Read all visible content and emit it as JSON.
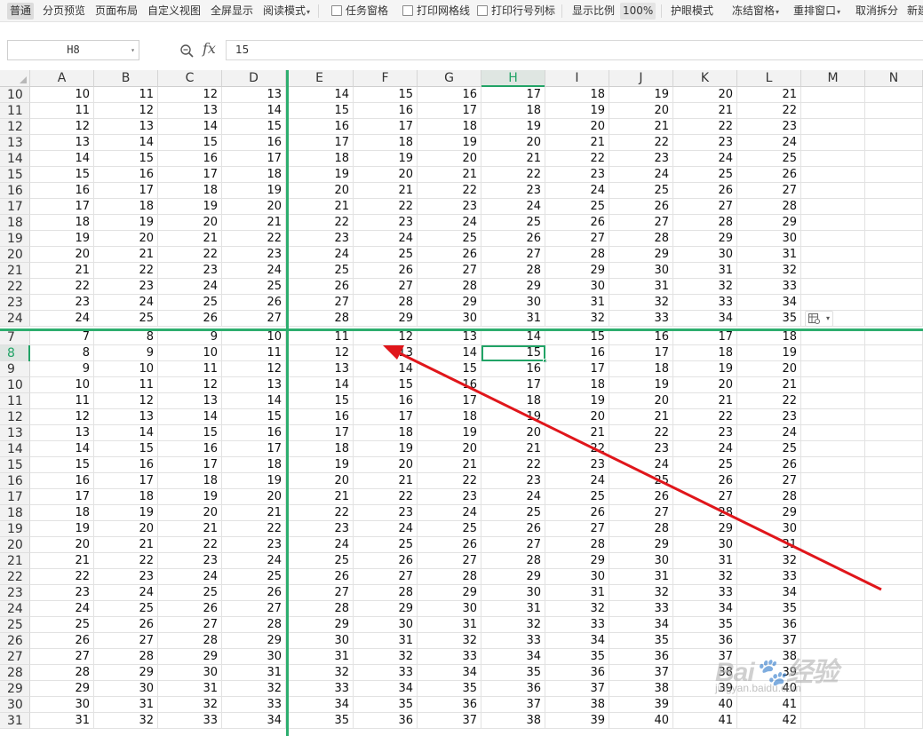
{
  "ribbon": {
    "items": [
      {
        "label": "普通",
        "kind": "button",
        "active": true
      },
      {
        "label": "分页预览",
        "kind": "button"
      },
      {
        "label": "页面布局",
        "kind": "button"
      },
      {
        "label": "自定义视图",
        "kind": "button"
      },
      {
        "label": "全屏显示",
        "kind": "button"
      },
      {
        "label": "阅读模式",
        "kind": "dropdown"
      },
      {
        "label": "任务窗格",
        "kind": "checkbox"
      },
      {
        "label": "打印网格线",
        "kind": "checkbox"
      },
      {
        "label": "打印行号列标",
        "kind": "checkbox"
      },
      {
        "label": "显示比例",
        "kind": "button"
      },
      {
        "label": "100%",
        "kind": "zoom"
      },
      {
        "label": "护眼模式",
        "kind": "button"
      },
      {
        "label": "冻结窗格",
        "kind": "dropdown"
      },
      {
        "label": "重排窗口",
        "kind": "dropdown"
      },
      {
        "label": "取消拆分",
        "kind": "button"
      },
      {
        "label": "新建",
        "kind": "button"
      }
    ]
  },
  "formula_bar": {
    "name_box": "H8",
    "fx": "fx",
    "value": "15"
  },
  "columns": [
    "A",
    "B",
    "C",
    "D",
    "E",
    "F",
    "G",
    "H",
    "I",
    "J",
    "K",
    "L",
    "M",
    "N"
  ],
  "selected_column": "H",
  "selected_row": "8",
  "active_cell": {
    "row": 8,
    "col": "H",
    "value": 15
  },
  "top_pane": {
    "rows": [
      {
        "n": "10",
        "cells": [
          10,
          11,
          12,
          13,
          14,
          15,
          16,
          17,
          18,
          19,
          20,
          21
        ]
      },
      {
        "n": "11",
        "cells": [
          11,
          12,
          13,
          14,
          15,
          16,
          17,
          18,
          19,
          20,
          21,
          22
        ]
      },
      {
        "n": "12",
        "cells": [
          12,
          13,
          14,
          15,
          16,
          17,
          18,
          19,
          20,
          21,
          22,
          23
        ]
      },
      {
        "n": "13",
        "cells": [
          13,
          14,
          15,
          16,
          17,
          18,
          19,
          20,
          21,
          22,
          23,
          24
        ]
      },
      {
        "n": "14",
        "cells": [
          14,
          15,
          16,
          17,
          18,
          19,
          20,
          21,
          22,
          23,
          24,
          25
        ]
      },
      {
        "n": "15",
        "cells": [
          15,
          16,
          17,
          18,
          19,
          20,
          21,
          22,
          23,
          24,
          25,
          26
        ]
      },
      {
        "n": "16",
        "cells": [
          16,
          17,
          18,
          19,
          20,
          21,
          22,
          23,
          24,
          25,
          26,
          27
        ]
      },
      {
        "n": "17",
        "cells": [
          17,
          18,
          19,
          20,
          21,
          22,
          23,
          24,
          25,
          26,
          27,
          28
        ]
      },
      {
        "n": "18",
        "cells": [
          18,
          19,
          20,
          21,
          22,
          23,
          24,
          25,
          26,
          27,
          28,
          29
        ]
      },
      {
        "n": "19",
        "cells": [
          19,
          20,
          21,
          22,
          23,
          24,
          25,
          26,
          27,
          28,
          29,
          30
        ]
      },
      {
        "n": "20",
        "cells": [
          20,
          21,
          22,
          23,
          24,
          25,
          26,
          27,
          28,
          29,
          30,
          31
        ]
      },
      {
        "n": "21",
        "cells": [
          21,
          22,
          23,
          24,
          25,
          26,
          27,
          28,
          29,
          30,
          31,
          32
        ]
      },
      {
        "n": "22",
        "cells": [
          22,
          23,
          24,
          25,
          26,
          27,
          28,
          29,
          30,
          31,
          32,
          33
        ]
      },
      {
        "n": "23",
        "cells": [
          23,
          24,
          25,
          26,
          27,
          28,
          29,
          30,
          31,
          32,
          33,
          34
        ]
      },
      {
        "n": "24",
        "cells": [
          24,
          25,
          26,
          27,
          28,
          29,
          30,
          31,
          32,
          33,
          34,
          35
        ]
      }
    ]
  },
  "bottom_pane": {
    "rows": [
      {
        "n": "7",
        "cells": [
          7,
          8,
          9,
          10,
          11,
          12,
          13,
          14,
          15,
          16,
          17,
          18
        ]
      },
      {
        "n": "8",
        "cells": [
          8,
          9,
          10,
          11,
          12,
          13,
          14,
          15,
          16,
          17,
          18,
          19
        ]
      },
      {
        "n": "9",
        "cells": [
          9,
          10,
          11,
          12,
          13,
          14,
          15,
          16,
          17,
          18,
          19,
          20
        ]
      },
      {
        "n": "10",
        "cells": [
          10,
          11,
          12,
          13,
          14,
          15,
          16,
          17,
          18,
          19,
          20,
          21
        ]
      },
      {
        "n": "11",
        "cells": [
          11,
          12,
          13,
          14,
          15,
          16,
          17,
          18,
          19,
          20,
          21,
          22
        ]
      },
      {
        "n": "12",
        "cells": [
          12,
          13,
          14,
          15,
          16,
          17,
          18,
          19,
          20,
          21,
          22,
          23
        ]
      },
      {
        "n": "13",
        "cells": [
          13,
          14,
          15,
          16,
          17,
          18,
          19,
          20,
          21,
          22,
          23,
          24
        ]
      },
      {
        "n": "14",
        "cells": [
          14,
          15,
          16,
          17,
          18,
          19,
          20,
          21,
          22,
          23,
          24,
          25
        ]
      },
      {
        "n": "15",
        "cells": [
          15,
          16,
          17,
          18,
          19,
          20,
          21,
          22,
          23,
          24,
          25,
          26
        ]
      },
      {
        "n": "16",
        "cells": [
          16,
          17,
          18,
          19,
          20,
          21,
          22,
          23,
          24,
          25,
          26,
          27
        ]
      },
      {
        "n": "17",
        "cells": [
          17,
          18,
          19,
          20,
          21,
          22,
          23,
          24,
          25,
          26,
          27,
          28
        ]
      },
      {
        "n": "18",
        "cells": [
          18,
          19,
          20,
          21,
          22,
          23,
          24,
          25,
          26,
          27,
          28,
          29
        ]
      },
      {
        "n": "19",
        "cells": [
          19,
          20,
          21,
          22,
          23,
          24,
          25,
          26,
          27,
          28,
          29,
          30
        ]
      },
      {
        "n": "20",
        "cells": [
          20,
          21,
          22,
          23,
          24,
          25,
          26,
          27,
          28,
          29,
          30,
          31
        ]
      },
      {
        "n": "21",
        "cells": [
          21,
          22,
          23,
          24,
          25,
          26,
          27,
          28,
          29,
          30,
          31,
          32
        ]
      },
      {
        "n": "22",
        "cells": [
          22,
          23,
          24,
          25,
          26,
          27,
          28,
          29,
          30,
          31,
          32,
          33
        ]
      },
      {
        "n": "23",
        "cells": [
          23,
          24,
          25,
          26,
          27,
          28,
          29,
          30,
          31,
          32,
          33,
          34
        ]
      },
      {
        "n": "24",
        "cells": [
          24,
          25,
          26,
          27,
          28,
          29,
          30,
          31,
          32,
          33,
          34,
          35
        ]
      },
      {
        "n": "25",
        "cells": [
          25,
          26,
          27,
          28,
          29,
          30,
          31,
          32,
          33,
          34,
          35,
          36
        ]
      },
      {
        "n": "26",
        "cells": [
          26,
          27,
          28,
          29,
          30,
          31,
          32,
          33,
          34,
          35,
          36,
          37
        ]
      },
      {
        "n": "27",
        "cells": [
          27,
          28,
          29,
          30,
          31,
          32,
          33,
          34,
          35,
          36,
          37,
          38
        ]
      },
      {
        "n": "28",
        "cells": [
          28,
          29,
          30,
          31,
          32,
          33,
          34,
          35,
          36,
          37,
          38,
          39
        ]
      },
      {
        "n": "29",
        "cells": [
          29,
          30,
          31,
          32,
          33,
          34,
          35,
          36,
          37,
          38,
          39,
          40
        ]
      },
      {
        "n": "30",
        "cells": [
          30,
          31,
          32,
          33,
          34,
          35,
          36,
          37,
          38,
          39,
          40,
          41
        ]
      },
      {
        "n": "31",
        "cells": [
          31,
          32,
          33,
          34,
          35,
          36,
          37,
          38,
          39,
          40,
          41,
          42
        ]
      }
    ]
  },
  "colors": {
    "freeze_line": "#2eae6f",
    "selection": "#21a366",
    "annotation_arrow": "#e0161b"
  },
  "watermark": {
    "logo": "Bai 经验",
    "url": "jingyan.baidu.com"
  }
}
